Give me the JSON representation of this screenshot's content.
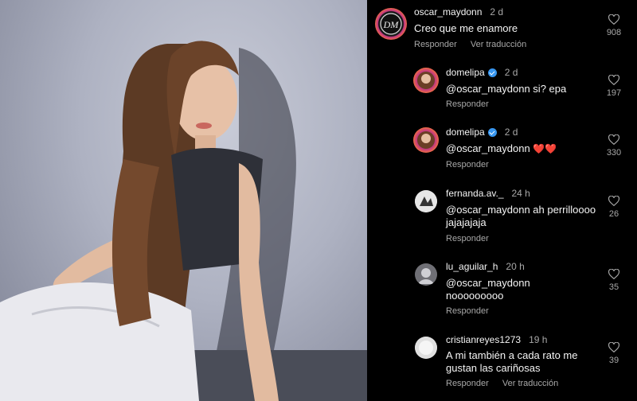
{
  "comments": [
    {
      "username": "oscar_maydonn",
      "time": "2 d",
      "text": "Creo que me enamore",
      "reply": "Responder",
      "translate": "Ver traducción",
      "likes": "908",
      "avatar": "oscar-avatar-icon"
    },
    {
      "username": "domelipa",
      "verified": true,
      "time": "2 d",
      "text": "@oscar_maydonn si? epa",
      "reply": "Responder",
      "likes": "197",
      "avatar": "domelipa-avatar-icon"
    },
    {
      "username": "domelipa",
      "verified": true,
      "time": "2 d",
      "text": "@oscar_maydonn",
      "emoji": "❤️❤️",
      "reply": "Responder",
      "likes": "330",
      "avatar": "domelipa-avatar-icon"
    },
    {
      "username": "fernanda.av._",
      "time": "24 h",
      "text": "@oscar_maydonn ah perrilloooo jajajajaja",
      "reply": "Responder",
      "likes": "26",
      "avatar": "fernanda-avatar-icon"
    },
    {
      "username": "lu_aguilar_h",
      "time": "20 h",
      "text": "@oscar_maydonn nooooooooo",
      "reply": "Responder",
      "likes": "35",
      "avatar": "lu-avatar-icon"
    },
    {
      "username": "cristianreyes1273",
      "time": "19 h",
      "text": "A mi también a cada rato me gustan las cariñosas",
      "reply": "Responder",
      "translate": "Ver traducción",
      "likes": "39",
      "avatar": "default-avatar-icon"
    }
  ],
  "colors": {
    "background": "#000000",
    "muted": "#a8a8a8",
    "verified": "#3897f0",
    "heart": "#e0245e"
  }
}
